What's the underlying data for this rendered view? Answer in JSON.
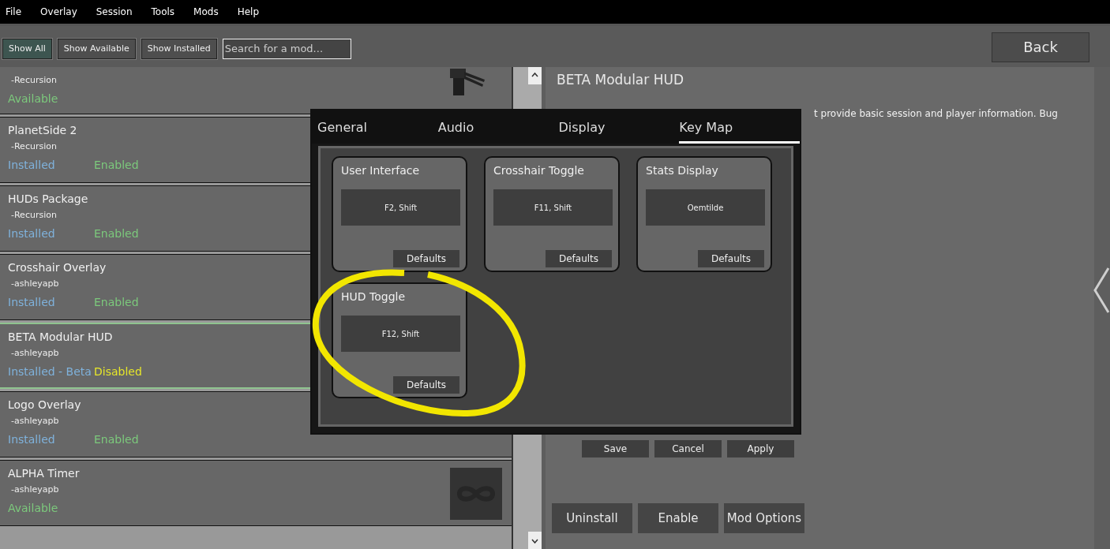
{
  "menu": [
    "File",
    "Overlay",
    "Session",
    "Tools",
    "Mods",
    "Help"
  ],
  "filters": [
    {
      "label": "Show All",
      "selected": true
    },
    {
      "label": "Show Available",
      "selected": false
    },
    {
      "label": "Show Installed",
      "selected": false
    }
  ],
  "search": {
    "placeholder": "Search for a mod..."
  },
  "back_button": "Back",
  "mods": [
    {
      "author": "-Recursion",
      "kind": "photo",
      "selected": false,
      "statuses": [
        {
          "text": "Available",
          "kind": "available"
        }
      ]
    },
    {
      "name": "PlanetSide 2",
      "author": "-Recursion",
      "selected": false,
      "statuses": [
        {
          "text": "Installed",
          "kind": "installed"
        },
        {
          "text": "Enabled",
          "kind": "enabled"
        }
      ]
    },
    {
      "name": "HUDs Package",
      "author": "-Recursion",
      "selected": false,
      "statuses": [
        {
          "text": "Installed",
          "kind": "installed"
        },
        {
          "text": "Enabled",
          "kind": "enabled"
        }
      ]
    },
    {
      "name": "Crosshair Overlay",
      "author": "-ashleyapb",
      "selected": false,
      "statuses": [
        {
          "text": "Installed",
          "kind": "installed"
        },
        {
          "text": "Enabled",
          "kind": "enabled"
        }
      ]
    },
    {
      "name": "BETA Modular HUD",
      "author": "-ashleyapb",
      "selected": true,
      "statuses": [
        {
          "text": "Installed - Beta",
          "kind": "installed"
        },
        {
          "text": "Disabled",
          "kind": "disabled"
        }
      ]
    },
    {
      "name": "Logo Overlay",
      "author": "-ashleyapb",
      "selected": false,
      "statuses": [
        {
          "text": "Installed",
          "kind": "installed"
        },
        {
          "text": "Enabled",
          "kind": "enabled"
        }
      ]
    },
    {
      "name": "ALPHA Timer",
      "author": "-ashleyapb",
      "kind": "infinity",
      "selected": false,
      "statuses": [
        {
          "text": "Available",
          "kind": "available"
        }
      ]
    }
  ],
  "detail": {
    "title": "BETA Modular HUD",
    "description": "t provide basic session and player information. Bug",
    "buttons": [
      "Uninstall",
      "Enable",
      "Mod Options"
    ]
  },
  "dialog": {
    "tabs": [
      {
        "label": "General",
        "selected": false
      },
      {
        "label": "Audio",
        "selected": false
      },
      {
        "label": "Display",
        "selected": false
      },
      {
        "label": "Key Map",
        "selected": true
      }
    ],
    "bindings": [
      {
        "name": "User Interface",
        "keys": "F2, Shift",
        "button": "Defaults"
      },
      {
        "name": "Crosshair Toggle",
        "keys": "F11, Shift",
        "button": "Defaults"
      },
      {
        "name": "Stats Display",
        "keys": "Oemtilde",
        "button": "Defaults"
      },
      {
        "name": "HUD Toggle",
        "keys": "F12, Shift",
        "button": "Defaults",
        "highlighted": true
      }
    ],
    "buttons": [
      "Save",
      "Cancel",
      "Apply"
    ]
  }
}
